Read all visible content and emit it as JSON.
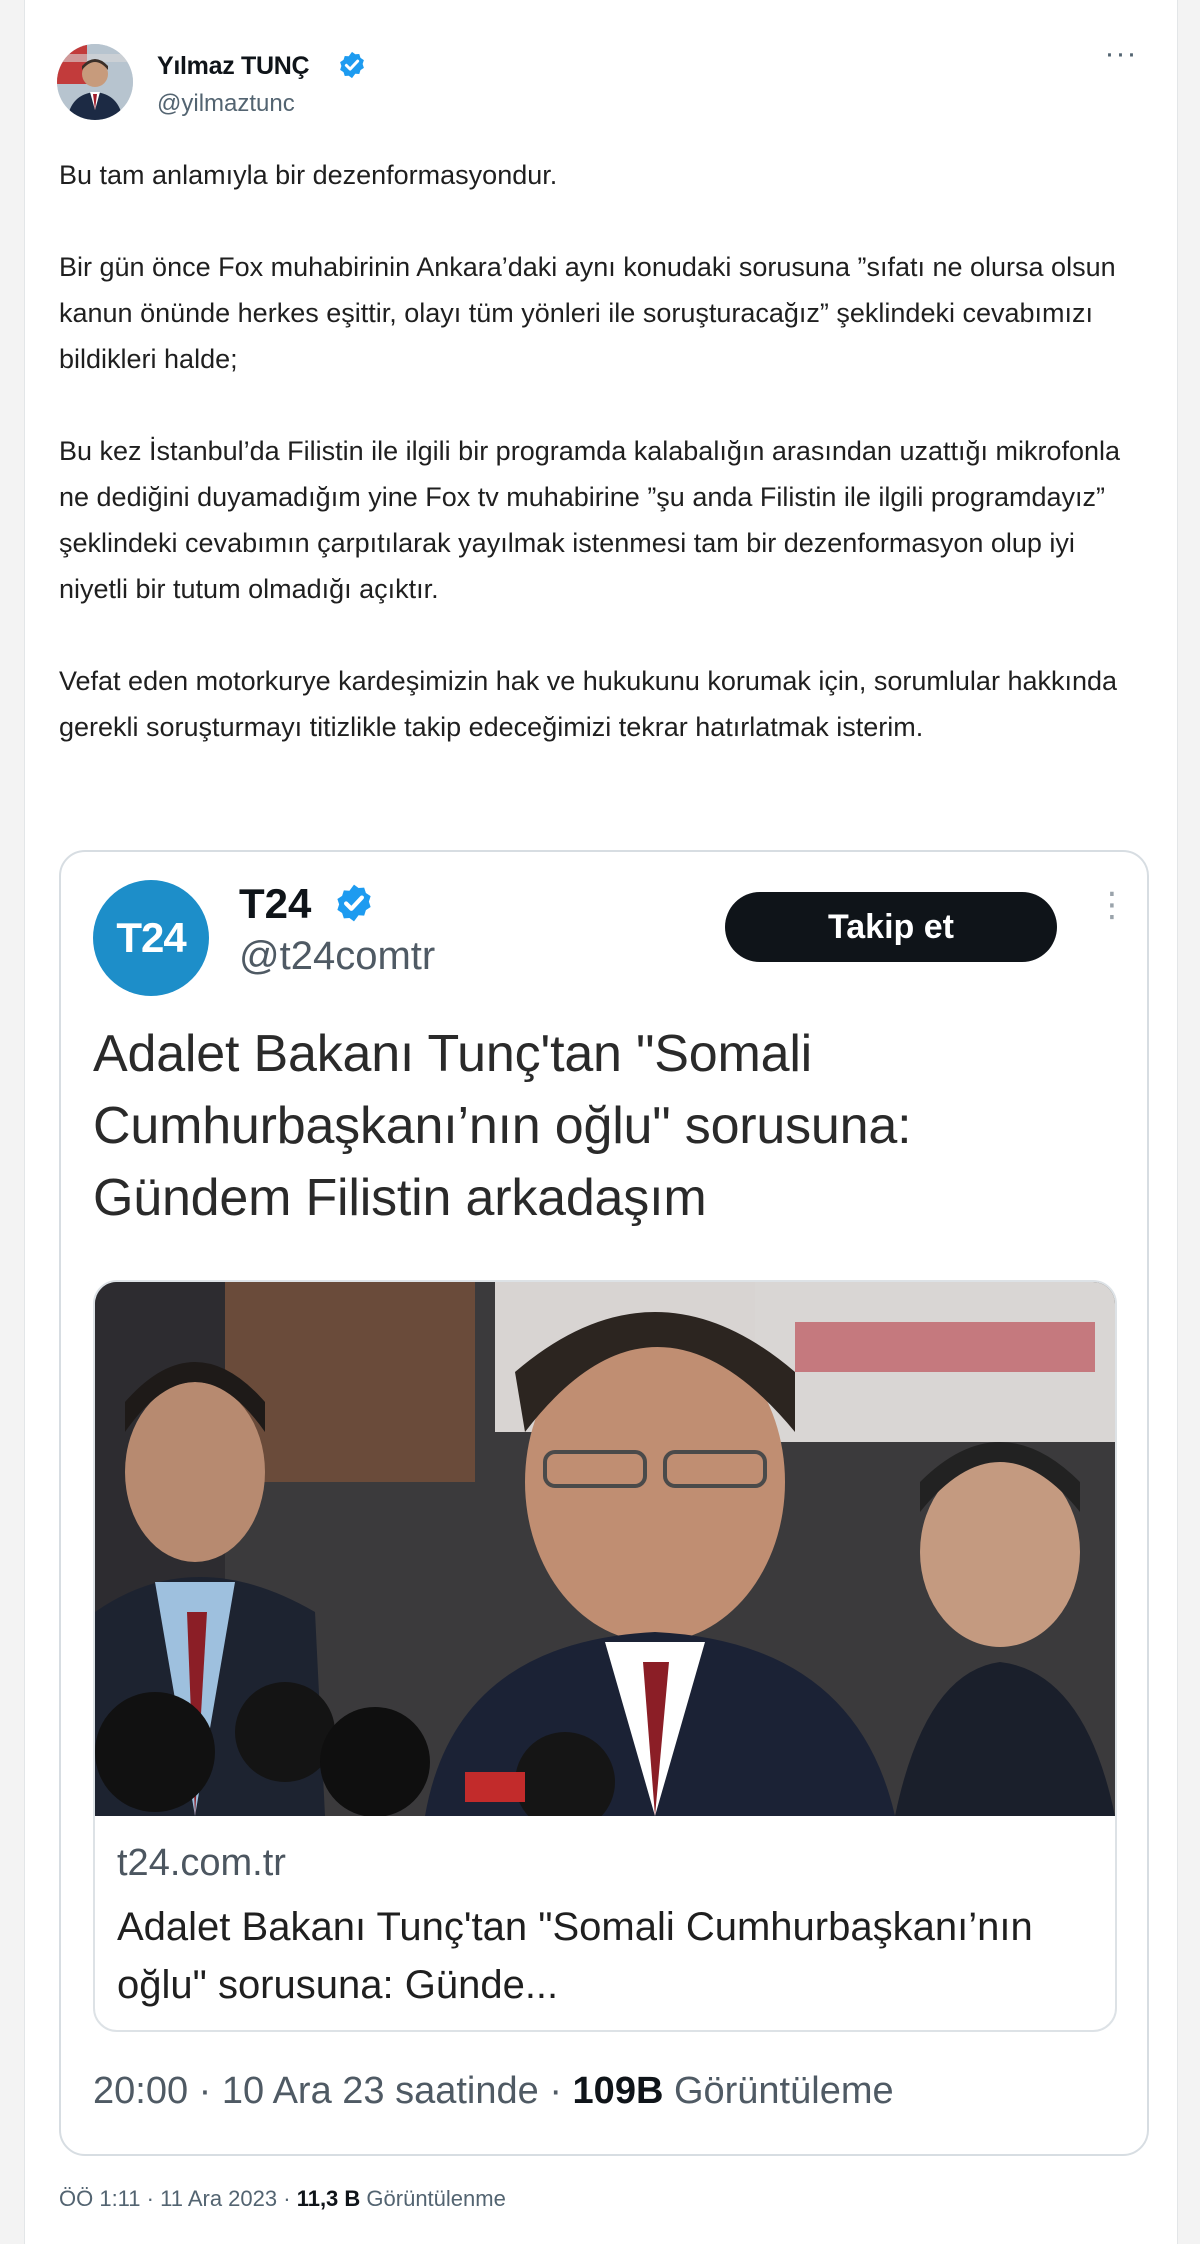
{
  "tweet": {
    "author_name": "Yılmaz TUNÇ",
    "author_handle": "@yilmaztunc",
    "more_label": "···",
    "paragraphs": [
      "Bu tam anlamıyla bir dezenformasyondur.",
      "Bir gün önce Fox muhabirinin Ankara’daki aynı konudaki sorusuna ”sıfatı ne olursa olsun kanun önünde herkes eşittir, olayı tüm yönleri ile soruşturacağız” şeklindeki cevabımızı bildikleri halde;",
      "Bu kez İstanbul’da Filistin ile ilgili bir programda kalabalığın arasından uzattığı mikrofonla ne dediğini duyamadığım yine Fox tv muhabirine ”şu anda Filistin ile ilgili programdayız” şeklindeki cevabımın çarpıtılarak yayılmak istenmesi tam bir dezenformasyon olup iyi niyetli bir tutum olmadığı açıktır.",
      "Vefat eden motorkurye kardeşimizin hak ve hukukunu korumak için, sorumlular hakkında gerekli soruşturmayı titizlikle takip edeceğimizi tekrar hatırlatmak isterim."
    ],
    "time": "ÖÖ 1:11",
    "sep": " · ",
    "date": "11 Ara 2023",
    "views": "11,3 B",
    "views_label": " Görüntülenme"
  },
  "quote": {
    "logo_text": "T24",
    "name": "T24",
    "handle": "@t24comtr",
    "follow_label": "Takip et",
    "more_label": "⋮",
    "text": "Adalet Bakanı Tunç'tan \"Somali Cumhurbaşkanı’nın oğlu\" sorusuna: Gündem Filistin arkadaşım",
    "card_domain": "t24.com.tr",
    "card_title": "Adalet Bakanı Tunç'tan \"Somali Cumhurbaşkanı’nın oğlu\" sorusuna: Günde...",
    "time": "20:00 · 10 Ara 23 saatinde · ",
    "views": "109B",
    "views_label": " Görüntüleme"
  },
  "colors": {
    "verified": "#1d9bf0",
    "logo_bg": "#1d8ec9",
    "follow_bg": "#0f1419"
  }
}
